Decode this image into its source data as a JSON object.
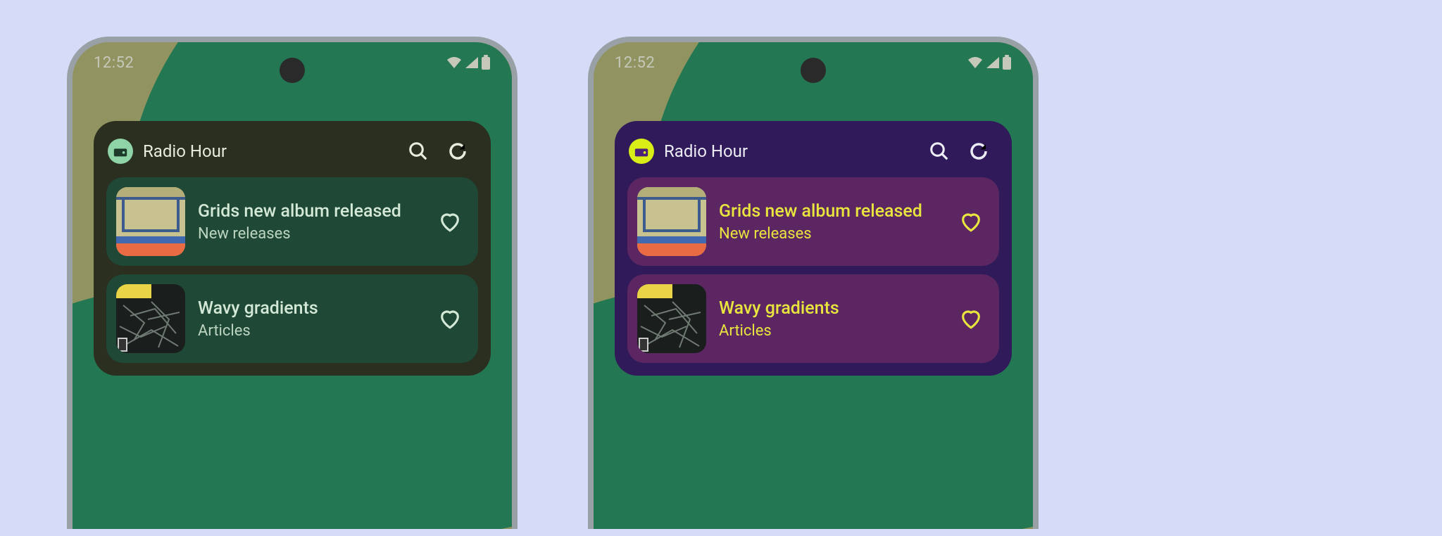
{
  "status": {
    "time": "12:52"
  },
  "widget": {
    "title": "Radio Hour",
    "items": [
      {
        "title": "Grids new album released",
        "subtitle": "New releases"
      },
      {
        "title": "Wavy gradients",
        "subtitle": "Articles"
      }
    ]
  },
  "themes": {
    "a": {
      "widget_bg": "#2b2f1f",
      "card_bg": "#1f4836",
      "accent_bg": "#8fd4a6",
      "text": "#d3e8d6"
    },
    "b": {
      "widget_bg": "#301a5a",
      "card_bg": "#5b2661",
      "accent_bg": "#d9ee17",
      "text": "#e8e53f"
    }
  },
  "icons": {
    "app": "radio-icon",
    "search": "search-icon",
    "refresh": "refresh-icon",
    "favorite": "heart-icon",
    "status": [
      "wifi-icon",
      "signal-icon",
      "battery-icon"
    ]
  }
}
